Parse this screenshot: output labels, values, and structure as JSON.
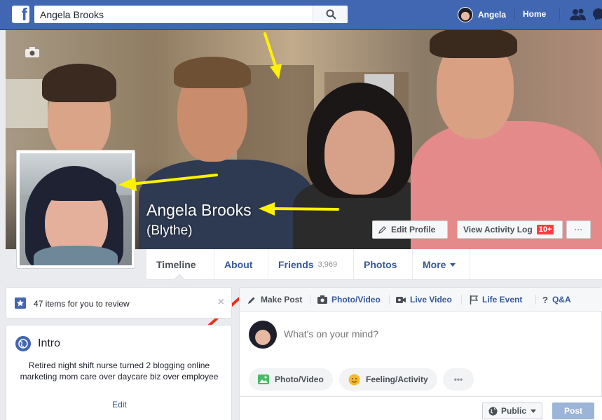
{
  "topbar": {
    "logo": "f",
    "search_value": "Angela Brooks",
    "user_name": "Angela",
    "home_label": "Home",
    "brand_color": "#4267b2"
  },
  "cover": {
    "name": "Angela Brooks",
    "alternate_name": "(Blythe)",
    "edit_profile_label": "Edit Profile",
    "activity_log_label": "View Activity Log",
    "activity_badge": "10+",
    "more_label": "···",
    "arrow_color": "#fff200"
  },
  "tabs": [
    {
      "label": "Timeline"
    },
    {
      "label": "About"
    },
    {
      "label": "Friends",
      "count": "3,969"
    },
    {
      "label": "Photos"
    },
    {
      "label": "More"
    }
  ],
  "review": {
    "text": "47 items for you to review",
    "close": "×"
  },
  "intro": {
    "title": "Intro",
    "bio": "Retired night shift nurse turned 2 blogging online marketing mom care over daycare biz over employee",
    "edit_label": "Edit",
    "arrow_color": "#e8321e"
  },
  "composer": {
    "tabs": [
      {
        "label": "Make Post",
        "icon": "pencil-icon"
      },
      {
        "label": "Photo/Video",
        "icon": "camera-icon"
      },
      {
        "label": "Live Video",
        "icon": "video-icon"
      },
      {
        "label": "Life Event",
        "icon": "flag-icon"
      },
      {
        "label": "Q&A",
        "icon": "question-icon"
      }
    ],
    "placeholder": "What's on your mind?",
    "photo_video_label": "Photo/Video",
    "feeling_label": "Feeling/Activity",
    "more_label": "•••",
    "privacy_label": "Public",
    "post_label": "Post"
  }
}
